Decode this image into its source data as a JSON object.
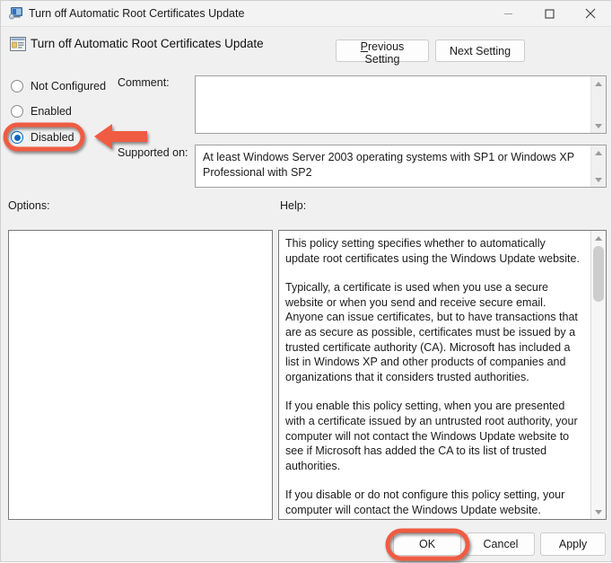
{
  "window": {
    "title": "Turn off Automatic Root Certificates Update",
    "icon": "policy-window-icon",
    "minimize_label": "Minimize",
    "maximize_label": "Maximize",
    "close_label": "Close"
  },
  "header": {
    "icon": "group-policy-setting-icon",
    "title": "Turn off Automatic Root Certificates Update",
    "previous_setting": "Previous Setting",
    "next_setting": "Next Setting"
  },
  "state_options": [
    {
      "label": "Not Configured",
      "selected": false
    },
    {
      "label": "Enabled",
      "selected": false
    },
    {
      "label": "Disabled",
      "selected": true
    }
  ],
  "comment": {
    "label": "Comment:",
    "value": "",
    "placeholder": ""
  },
  "supported_on": {
    "label": "Supported on:",
    "value": "At least Windows Server 2003 operating systems with SP1 or Windows XP Professional with SP2"
  },
  "options": {
    "label": "Options:",
    "value": ""
  },
  "help": {
    "label": "Help:",
    "paragraphs": [
      "This policy setting specifies whether to automatically update root certificates using the Windows Update website.",
      "Typically, a certificate is used when you use a secure website or when you send and receive secure email. Anyone can issue certificates, but to have transactions that are as secure as possible, certificates must be issued by a trusted certificate authority (CA). Microsoft has included a list in Windows XP and other products of companies and organizations that it considers trusted authorities.",
      "If you enable this policy setting, when you are presented with a certificate issued by an untrusted root authority, your computer will not contact the Windows Update website to see if Microsoft has added the CA to its list of trusted authorities.",
      "If you disable or do not configure this policy setting, your computer will contact the Windows Update website."
    ]
  },
  "footer": {
    "ok": "OK",
    "cancel": "Cancel",
    "apply": "Apply"
  },
  "annotations": {
    "color": "#ef5b43",
    "highlight_disabled": "ellipse-around-disabled-radio",
    "arrow_to_disabled": "left-pointing-arrow",
    "highlight_ok": "ellipse-around-ok-button"
  }
}
